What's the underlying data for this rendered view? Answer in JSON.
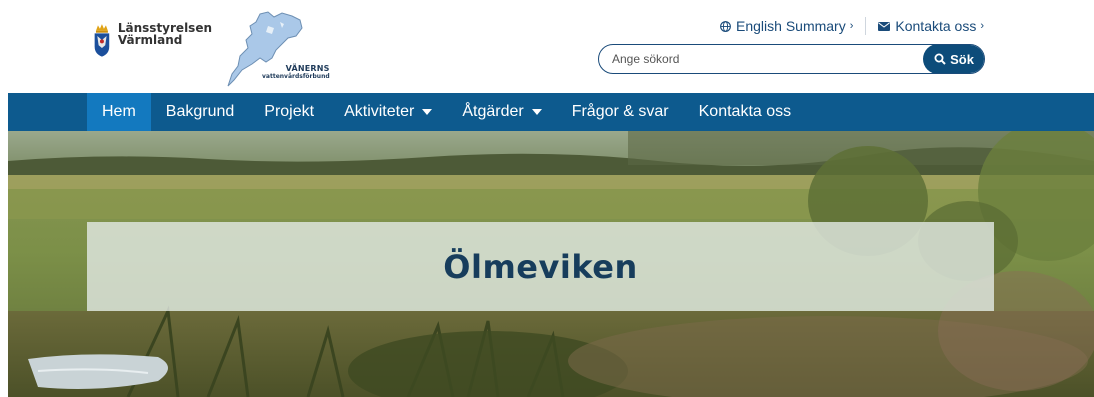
{
  "header": {
    "logo_main": {
      "line1": "Länsstyrelsen",
      "line2": "Värmland"
    },
    "logo_partner": {
      "line1": "VÄNERNS",
      "line2": "vattenvårdsförbund"
    },
    "links": [
      {
        "label": "English Summary",
        "icon": "globe-icon"
      },
      {
        "label": "Kontakta oss",
        "icon": "envelope-icon"
      }
    ],
    "search": {
      "placeholder": "Ange sökord",
      "button_label": "Sök"
    }
  },
  "nav": {
    "items": [
      {
        "label": "Hem",
        "active": true
      },
      {
        "label": "Bakgrund"
      },
      {
        "label": "Projekt"
      },
      {
        "label": "Aktiviteter",
        "dropdown": true
      },
      {
        "label": "Åtgärder",
        "dropdown": true
      },
      {
        "label": "Frågor & svar"
      },
      {
        "label": "Kontakta oss"
      }
    ]
  },
  "hero": {
    "title": "Ölmeviken"
  },
  "colors": {
    "nav_bg": "#0d5a8e",
    "nav_active": "#1379bf",
    "brand_dark": "#0d4c7a",
    "title_text": "#173d5c"
  }
}
